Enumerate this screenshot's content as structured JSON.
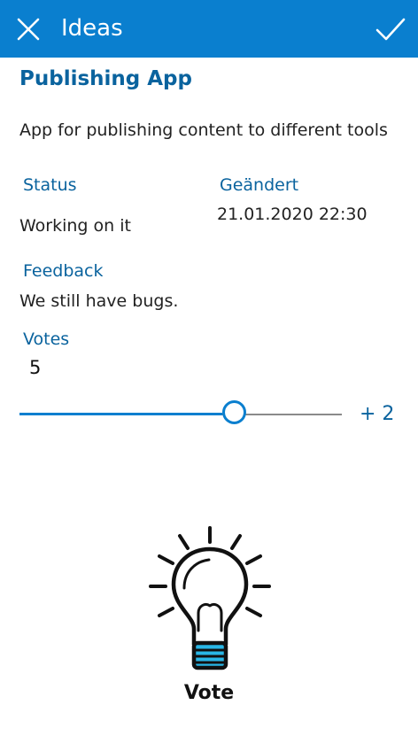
{
  "header": {
    "title": "Ideas",
    "close_icon": "close-icon",
    "confirm_icon": "checkmark-icon",
    "background": "#0a7fcf"
  },
  "idea": {
    "title": "Publishing App",
    "description": "App for publishing content to different tools"
  },
  "status": {
    "label": "Status",
    "value": "Working on it"
  },
  "changed": {
    "label": "Geändert",
    "value": "21.01.2020 22:30"
  },
  "feedback": {
    "label": "Feedback",
    "value": "We still have bugs."
  },
  "votes": {
    "label": "Votes",
    "count": "5"
  },
  "slider": {
    "value_label": "+ 2",
    "level_fraction": 0.665
  },
  "vote_button": {
    "icon": "lightbulb-icon",
    "label": "Vote"
  },
  "colors": {
    "accent": "#0a7fcf",
    "label_blue": "#0a639e",
    "bulb_base": "#29b6e6"
  }
}
